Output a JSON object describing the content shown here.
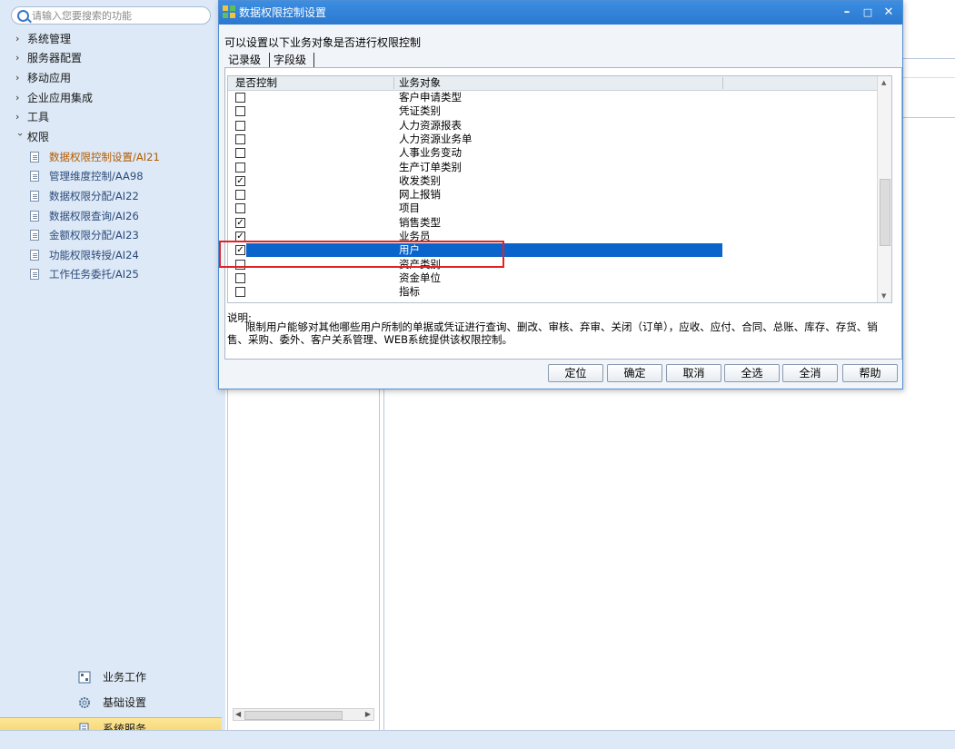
{
  "sidebar": {
    "search_placeholder": "请输入您要搜索的功能",
    "nav": [
      {
        "label": "系统管理",
        "expanded": false
      },
      {
        "label": "服务器配置",
        "expanded": false
      },
      {
        "label": "移动应用",
        "expanded": false
      },
      {
        "label": "企业应用集成",
        "expanded": false
      },
      {
        "label": "工具",
        "expanded": false
      },
      {
        "label": "权限",
        "expanded": true
      }
    ],
    "sub_items": [
      {
        "label": "数据权限控制设置/AI21",
        "active": true
      },
      {
        "label": "管理维度控制/AA98",
        "active": false
      },
      {
        "label": "数据权限分配/AI22",
        "active": false
      },
      {
        "label": "数据权限查询/AI26",
        "active": false
      },
      {
        "label": "金额权限分配/AI23",
        "active": false
      },
      {
        "label": "功能权限转授/AI24",
        "active": false
      },
      {
        "label": "工作任务委托/AI25",
        "active": false
      }
    ],
    "bottom_nav": [
      {
        "label": "业务工作",
        "icon": "business-icon"
      },
      {
        "label": "基础设置",
        "icon": "gear-icon"
      },
      {
        "label": "系统服务",
        "icon": "service-icon",
        "active": true
      }
    ]
  },
  "dialog": {
    "title": "数据权限控制设置",
    "description": "可以设置以下业务对象是否进行权限控制",
    "tabs": [
      "记录级",
      "字段级"
    ],
    "active_tab": 0,
    "columns": [
      "是否控制",
      "业务对象"
    ],
    "rows": [
      {
        "name": "客户申请类型",
        "checked": false
      },
      {
        "name": "凭证类别",
        "checked": false
      },
      {
        "name": "人力资源报表",
        "checked": false
      },
      {
        "name": "人力资源业务单",
        "checked": false
      },
      {
        "name": "人事业务变动",
        "checked": false
      },
      {
        "name": "生产订单类别",
        "checked": false
      },
      {
        "name": "收发类别",
        "checked": true
      },
      {
        "name": "网上报销",
        "checked": false
      },
      {
        "name": "项目",
        "checked": false
      },
      {
        "name": "销售类型",
        "checked": true
      },
      {
        "name": "业务员",
        "checked": true
      },
      {
        "name": "用户",
        "checked": true,
        "selected": true
      },
      {
        "name": "资产类别",
        "checked": false
      },
      {
        "name": "资金单位",
        "checked": false
      },
      {
        "name": "指标",
        "checked": false
      }
    ],
    "note_title": "说明:",
    "note_body": "限制用户能够对其他哪些用户所制的单据或凭证进行查询、删改、审核、弃审、关闭（订单），应收、应付、合同、总账、库存、存货、销售、采购、委外、客户关系管理、WEB系统提供该权限控制。",
    "buttons": [
      "定位",
      "确定",
      "取消",
      "全选",
      "全消",
      "帮助"
    ],
    "highlight_color": "#e02424",
    "accent_color": "#2b78cf"
  }
}
